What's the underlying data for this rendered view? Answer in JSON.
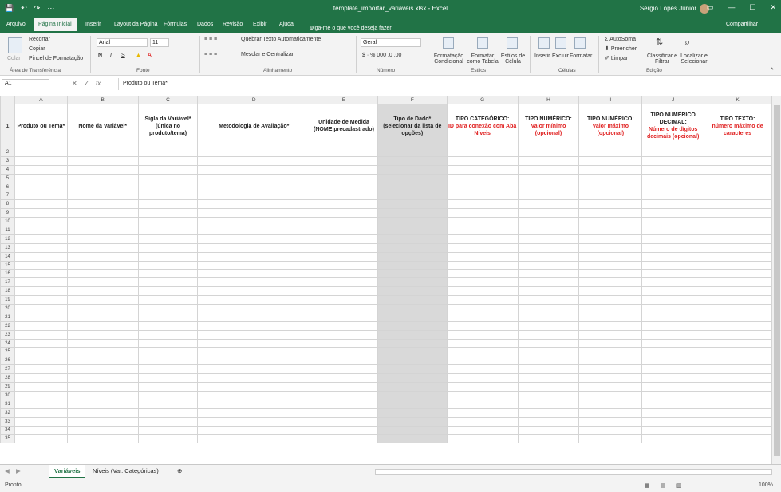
{
  "titlebar": {
    "qa": [
      "💾",
      "↶",
      "↷",
      "⋯"
    ],
    "title": "template_importar_variaveis.xlsx - Excel",
    "user": "Sergio Lopes Junior",
    "controls": [
      "▭",
      "—",
      "☐",
      "✕"
    ]
  },
  "tabs": [
    "Arquivo",
    "Página Inicial",
    "Inserir",
    "Layout da Página",
    "Fórmulas",
    "Dados",
    "Revisão",
    "Exibir",
    "Ajuda",
    "Diga-me o que você deseja fazer",
    "Compartilhar"
  ],
  "ribbon": {
    "clipboard": {
      "paste": "Colar",
      "cut": "Recortar",
      "copy": "Copiar",
      "format_painter": "Pincel de Formatação",
      "group": "Área de Transferência"
    },
    "font": {
      "name": "Arial",
      "size": "11",
      "bold": "N",
      "italic": "I",
      "underline": "S",
      "group": "Fonte"
    },
    "alignment": {
      "wrap": "Quebrar Texto Automaticamente",
      "merge": "Mesclar e Centralizar",
      "group": "Alinhamento"
    },
    "number": {
      "format": "Geral",
      "group": "Número"
    },
    "styles": {
      "cond": "Formatação Condicional",
      "table": "Formatar como Tabela",
      "cell": "Estilos de Célula",
      "group": "Estilos"
    },
    "cells": {
      "insert": "Inserir",
      "delete": "Excluir",
      "format": "Formatar",
      "group": "Células"
    },
    "editing": {
      "autosum": "AutoSoma",
      "fill": "Preencher",
      "clear": "Limpar",
      "sort": "Classificar e Filtrar",
      "find": "Localizar e Selecionar",
      "group": "Edição"
    }
  },
  "formula_bar": {
    "namebox": "A1",
    "fx": "fx",
    "content": "Produto ou Tema*"
  },
  "columns": [
    "A",
    "B",
    "C",
    "D",
    "E",
    "F",
    "G",
    "H",
    "I",
    "J",
    "K"
  ],
  "headers": [
    {
      "text": "Produto ou Tema*",
      "red": ""
    },
    {
      "text": "Nome da Variável*",
      "red": ""
    },
    {
      "text": "Sigla da Variável* (única no produto/tema)",
      "red": ""
    },
    {
      "text": "Metodologia de Avaliação*",
      "red": ""
    },
    {
      "text": "Unidade de Medida (NOME precadastrado)",
      "red": ""
    },
    {
      "text": "Tipo de Dado* (selecionar da lista de opções)",
      "red": ""
    },
    {
      "text": "TIPO CATEGÓRICO:",
      "red": "ID para conexão com Aba Níveis"
    },
    {
      "text": "TIPO NUMÉRICO:",
      "red": "Valor mínimo (opcional)"
    },
    {
      "text": "TIPO NUMÉRICO:",
      "red": "Valor máximo (opcional)"
    },
    {
      "text": "TIPO NUMÉRICO DECIMAL:",
      "red": "Número de dígitos decimais (opcional)"
    },
    {
      "text": "TIPO TEXTO:",
      "red": "número máximo de caracteres"
    }
  ],
  "sheets": [
    "Variáveis",
    "Níveis (Var. Categóricas)",
    "⊕"
  ],
  "status": {
    "ready": "Pronto",
    "zoom": "100%"
  }
}
